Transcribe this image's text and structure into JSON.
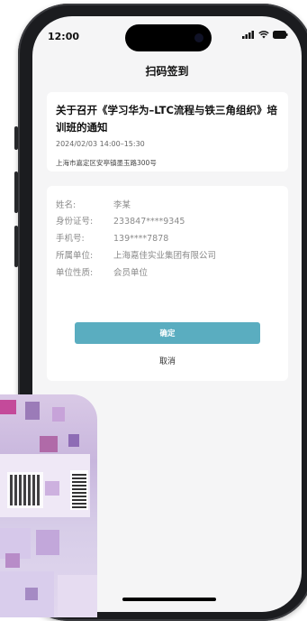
{
  "status_bar": {
    "time": "12:00",
    "icons": [
      "signal-icon",
      "wifi-icon",
      "battery-icon"
    ]
  },
  "page": {
    "title": "扫码签到"
  },
  "notice": {
    "title": "关于召开《学习华为–LTC流程与铁三角组织》培训班的通知",
    "time": "2024/02/03 14:00–15:30",
    "address": "上海市嘉定区安亭镇墨玉路300号"
  },
  "info": {
    "rows": [
      {
        "label": "姓名:",
        "value": "李某"
      },
      {
        "label": "身份证号:",
        "value": "233847****9345"
      },
      {
        "label": "手机号:",
        "value": "139****7878"
      },
      {
        "label": "所属单位:",
        "value": "上海嘉佳实业集团有限公司"
      },
      {
        "label": "单位性质:",
        "value": "会员单位"
      }
    ],
    "confirm_label": "确定",
    "cancel_label": "取消"
  },
  "colors": {
    "accent": "#5aadc0",
    "background": "#f5f5f6",
    "card": "#ffffff",
    "frame": "#1b1c1f"
  }
}
